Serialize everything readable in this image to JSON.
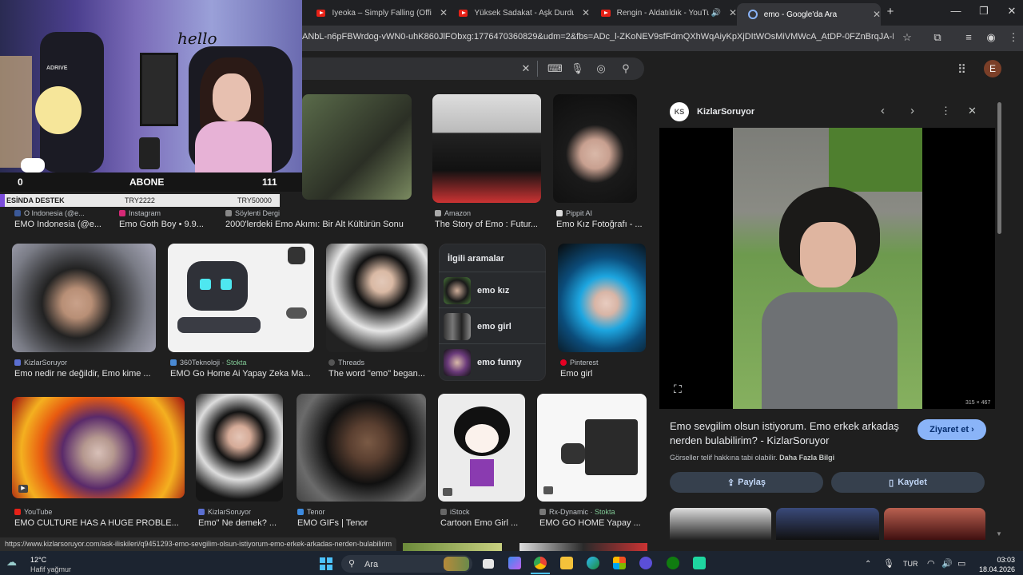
{
  "tabs": [
    {
      "title": "Iyeoka – Simply Falling (Official",
      "icon": "youtube-icon"
    },
    {
      "title": "Yüksek Sadakat - Aşk Durdukça",
      "icon": "youtube-icon"
    },
    {
      "title": "Rengin - Aldatıldık - YouTube",
      "icon": "youtube-icon"
    },
    {
      "title": "emo - Google'da Ara",
      "icon": "google-icon",
      "active": true
    }
  ],
  "new_tab_label": "+",
  "address_bar": {
    "url": "ANbL-n6pFBWrdog-vWN0-uhK860JlFObxg:1776470360829&udm=2&fbs=ADc_l-ZKoNEV9sfFdmQXhWqAiyKpXjDItWOsMiVMWcA_AtDP-0FZnBrqJA-DoJOe..."
  },
  "search": {
    "clear": "✕"
  },
  "avatar_letter": "E",
  "results": [
    {
      "source": "EMO Indonesia (@e...",
      "source_short": "O Indonesia (@e...",
      "title": "EMO Indonesia (@e..."
    },
    {
      "source": "Instagram",
      "title": "Emo Goth Boy • 9.9..."
    },
    {
      "source": "Söylenti Dergi",
      "title": "2000'lerdeki Emo Akımı: Bir Alt Kültürün Sonu"
    },
    {
      "source": "Amazon",
      "title": "The Story of Emo : Futur..."
    },
    {
      "source": "Pippit AI",
      "title": "Emo Kız Fotoğrafı - ..."
    },
    {
      "source": "KizlarSoruyor",
      "title": "Emo nedir ne değildir, Emo kime ..."
    },
    {
      "source": "360Teknoloji",
      "stock": "Stokta",
      "title": "EMO Go Home Ai Yapay Zeka Ma..."
    },
    {
      "source": "Threads",
      "title": "The word \"emo\" began..."
    },
    {
      "source": "Pinterest",
      "title": "Emo girl"
    },
    {
      "source": "YouTube",
      "title": "EMO CULTURE HAS A HUGE PROBLE..."
    },
    {
      "source": "KizlarSoruyor",
      "title": "Emo\" Ne demek? ..."
    },
    {
      "source": "Tenor",
      "title": "EMO GIFs | Tenor"
    },
    {
      "source": "iStock",
      "title": "Cartoon Emo Girl ..."
    },
    {
      "source": "Rx-Dynamic",
      "stock": "Stokta",
      "title": "EMO GO HOME Yapay ..."
    }
  ],
  "related": {
    "heading": "İlgili aramalar",
    "items": [
      "emo kız",
      "emo girl",
      "emo funny"
    ]
  },
  "panel": {
    "source": "KizlarSoruyor",
    "source_logo": "KS",
    "dimensions": "315 × 467",
    "title": "Emo sevgilim olsun istiyorum. Emo erkek arkadaş nerden bulabilirim? - KizlarSoruyor",
    "visit": "Ziyaret et",
    "copyright": "Görseller telif hakkına tabi olabilir.",
    "more_info": "Daha Fazla Bilgi",
    "share": "Paylaş",
    "save": "Kaydet"
  },
  "overlay": {
    "hello": "hello",
    "sub_left": "0",
    "sub_label": "ABONE",
    "sub_right": "111",
    "donate_label": "ESİNDA DESTEK",
    "donate_mid": "TRY2222",
    "donate_right": "TRY50000",
    "chair_brand": "ADRIVE"
  },
  "status_url": "https://www.kizlarsoruyor.com/ask-iliskileri/q9451293-emo-sevgilim-olsun-istiyorum-emo-erkek-arkadas-nerden-bulabilirim",
  "taskbar": {
    "weather_temp": "12°C",
    "weather_desc": "Hafif yağmur",
    "search_label": "Ara",
    "lang": "TUR",
    "time": "03:03",
    "date": "18.04.2026"
  },
  "colors": {
    "accent": "#8ab4f8",
    "stock": "#81c995",
    "bg": "#1f1f1f"
  }
}
